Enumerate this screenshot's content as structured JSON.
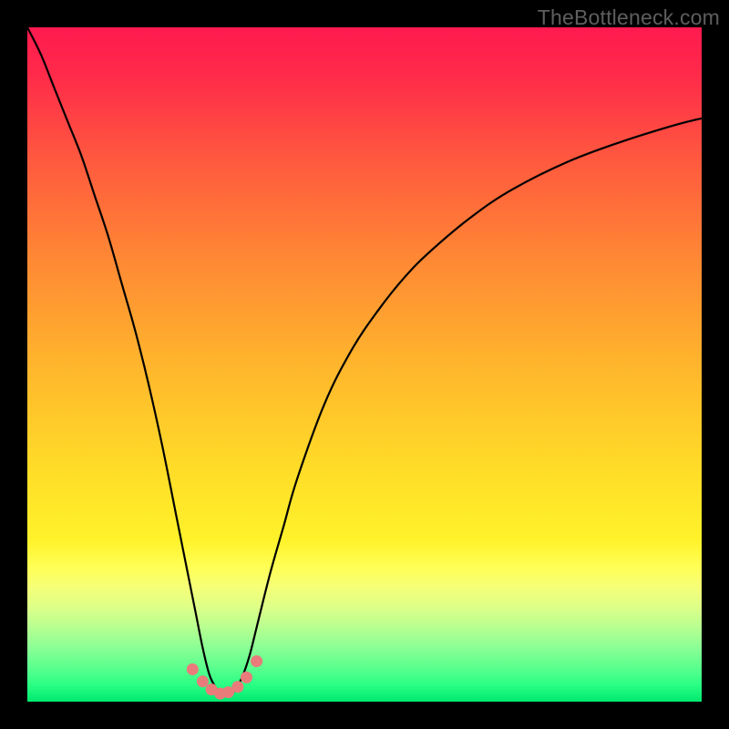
{
  "watermark": "TheBottleneck.com",
  "gradient_stops": [
    {
      "offset": 0.0,
      "color": "#ff1a4f"
    },
    {
      "offset": 0.07,
      "color": "#ff2a4a"
    },
    {
      "offset": 0.2,
      "color": "#ff5a3e"
    },
    {
      "offset": 0.35,
      "color": "#ff8a34"
    },
    {
      "offset": 0.5,
      "color": "#ffb52c"
    },
    {
      "offset": 0.65,
      "color": "#ffdb28"
    },
    {
      "offset": 0.76,
      "color": "#fff22a"
    },
    {
      "offset": 0.8,
      "color": "#ffff55"
    },
    {
      "offset": 0.83,
      "color": "#f6ff77"
    },
    {
      "offset": 0.86,
      "color": "#ddff88"
    },
    {
      "offset": 0.89,
      "color": "#b7ff91"
    },
    {
      "offset": 0.92,
      "color": "#8aff95"
    },
    {
      "offset": 0.95,
      "color": "#5aff8e"
    },
    {
      "offset": 0.975,
      "color": "#2aff84"
    },
    {
      "offset": 1.0,
      "color": "#00e86f"
    }
  ],
  "marker_color": "#e97b7b",
  "curve_color": "#000000",
  "chart_data": {
    "type": "line",
    "title": "",
    "xlabel": "",
    "ylabel": "",
    "xlim": [
      0,
      100
    ],
    "ylim": [
      0,
      100
    ],
    "grid": false,
    "legend": null,
    "annotations": [
      "TheBottleneck.com"
    ],
    "series": [
      {
        "name": "bottleneck-curve",
        "x": [
          0,
          2,
          4,
          6,
          8,
          10,
          12,
          14,
          16,
          18,
          20,
          22,
          23,
          24,
          25,
          26,
          27,
          28,
          29,
          30,
          31,
          32,
          33,
          34,
          36,
          38,
          40,
          44,
          48,
          52,
          56,
          60,
          66,
          72,
          80,
          88,
          96,
          100
        ],
        "y": [
          100,
          96,
          91,
          86,
          81,
          75,
          69,
          62,
          55,
          47,
          38,
          28,
          23,
          18,
          13,
          8,
          4,
          2,
          1,
          1,
          2,
          4,
          7,
          11,
          19,
          26,
          33,
          44,
          52,
          58,
          63,
          67,
          72,
          76,
          80,
          83,
          85.5,
          86.5
        ]
      }
    ],
    "markers": {
      "name": "highlight-points",
      "x": [
        24.5,
        26.0,
        27.3,
        28.6,
        29.8,
        31.2,
        32.5,
        34.0
      ],
      "y": [
        4.8,
        3.0,
        1.8,
        1.2,
        1.4,
        2.2,
        3.6,
        6.0
      ]
    }
  }
}
